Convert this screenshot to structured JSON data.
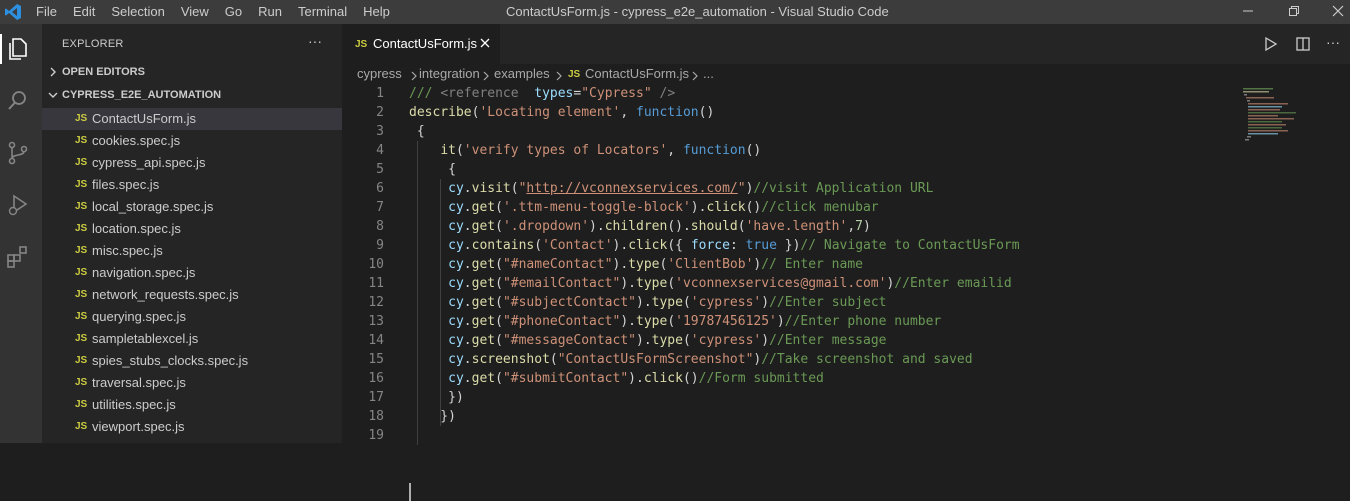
{
  "titlebar": {
    "menu": [
      "File",
      "Edit",
      "Selection",
      "View",
      "Go",
      "Run",
      "Terminal",
      "Help"
    ],
    "title": "ContactUsForm.js - cypress_e2e_automation - Visual Studio Code"
  },
  "sidebar": {
    "title": "EXPLORER",
    "more": "···",
    "open_editors": "OPEN EDITORS",
    "project": "CYPRESS_E2E_AUTOMATION",
    "file_badge": "JS",
    "files": [
      "ContactUsForm.js",
      "cookies.spec.js",
      "cypress_api.spec.js",
      "files.spec.js",
      "local_storage.spec.js",
      "location.spec.js",
      "misc.spec.js",
      "navigation.spec.js",
      "network_requests.spec.js",
      "querying.spec.js",
      "sampletablexcel.js",
      "spies_stubs_clocks.spec.js",
      "traversal.spec.js",
      "utilities.spec.js",
      "viewport.spec.js"
    ],
    "active_index": 0
  },
  "editor": {
    "tab": {
      "badge": "JS",
      "name": "ContactUsForm.js"
    },
    "more": "···",
    "breadcrumb": [
      "cypress",
      "integration",
      "examples",
      "ContactUsForm.js",
      "..."
    ],
    "breadcrumb_badge": "JS",
    "lines": [
      {
        "n": "1",
        "tokens": [
          [
            "/// ",
            "cm"
          ],
          [
            "<",
            "tg"
          ],
          [
            "reference",
            "tg"
          ],
          [
            "  ",
            "pl"
          ],
          [
            "types",
            "at"
          ],
          [
            "=",
            "pl"
          ],
          [
            "\"Cypress\"",
            "st"
          ],
          [
            " />",
            "tg"
          ]
        ]
      },
      {
        "n": "2",
        "tokens": [
          [
            "describe",
            "fn"
          ],
          [
            "(",
            "pl"
          ],
          [
            "'Locating element'",
            "st"
          ],
          [
            ", ",
            "pl"
          ],
          [
            "function",
            "kw"
          ],
          [
            "()",
            "pl"
          ]
        ]
      },
      {
        "n": "3",
        "tokens": [
          [
            " {",
            "pl"
          ]
        ]
      },
      {
        "n": "4",
        "tokens": [
          [
            "    ",
            "pl"
          ],
          [
            "it",
            "fn"
          ],
          [
            "(",
            "pl"
          ],
          [
            "'verify types of Locators'",
            "st"
          ],
          [
            ", ",
            "pl"
          ],
          [
            "function",
            "kw"
          ],
          [
            "()",
            "pl"
          ]
        ]
      },
      {
        "n": "5",
        "tokens": [
          [
            "     {",
            "pl"
          ]
        ]
      },
      {
        "n": "6",
        "tokens": [
          [
            "     ",
            "pl"
          ],
          [
            "cy",
            "vr"
          ],
          [
            ".",
            "pl"
          ],
          [
            "visit",
            "fn"
          ],
          [
            "(",
            "pl"
          ],
          [
            "\"",
            "st"
          ],
          [
            "http://vconnexservices.com/",
            "ul"
          ],
          [
            "\"",
            "st"
          ],
          [
            ")",
            "pl"
          ],
          [
            "//visit Application URL",
            "cm"
          ]
        ]
      },
      {
        "n": "7",
        "tokens": [
          [
            "     ",
            "pl"
          ],
          [
            "cy",
            "vr"
          ],
          [
            ".",
            "pl"
          ],
          [
            "get",
            "fn"
          ],
          [
            "(",
            "pl"
          ],
          [
            "'.ttm-menu-toggle-block'",
            "st"
          ],
          [
            ").",
            "pl"
          ],
          [
            "click",
            "fn"
          ],
          [
            "()",
            "pl"
          ],
          [
            "//click menubar",
            "cm"
          ]
        ]
      },
      {
        "n": "8",
        "tokens": [
          [
            "     ",
            "pl"
          ],
          [
            "cy",
            "vr"
          ],
          [
            ".",
            "pl"
          ],
          [
            "get",
            "fn"
          ],
          [
            "(",
            "pl"
          ],
          [
            "'.dropdown'",
            "st"
          ],
          [
            ").",
            "pl"
          ],
          [
            "children",
            "fn"
          ],
          [
            "().",
            "pl"
          ],
          [
            "should",
            "fn"
          ],
          [
            "(",
            "pl"
          ],
          [
            "'have.length'",
            "st"
          ],
          [
            ",",
            "pl"
          ],
          [
            "7",
            "nu"
          ],
          [
            ")",
            "pl"
          ]
        ]
      },
      {
        "n": "9",
        "tokens": [
          [
            "     ",
            "pl"
          ],
          [
            "cy",
            "vr"
          ],
          [
            ".",
            "pl"
          ],
          [
            "contains",
            "fn"
          ],
          [
            "(",
            "pl"
          ],
          [
            "'Contact'",
            "st"
          ],
          [
            ").",
            "pl"
          ],
          [
            "click",
            "fn"
          ],
          [
            "({ ",
            "pl"
          ],
          [
            "force",
            "vr"
          ],
          [
            ": ",
            "pl"
          ],
          [
            "true",
            "kw"
          ],
          [
            " })",
            "pl"
          ],
          [
            "// Navigate to ContactUsForm",
            "cm"
          ]
        ]
      },
      {
        "n": "10",
        "tokens": [
          [
            "     ",
            "pl"
          ],
          [
            "cy",
            "vr"
          ],
          [
            ".",
            "pl"
          ],
          [
            "get",
            "fn"
          ],
          [
            "(",
            "pl"
          ],
          [
            "\"#nameContact\"",
            "st"
          ],
          [
            ").",
            "pl"
          ],
          [
            "type",
            "fn"
          ],
          [
            "(",
            "pl"
          ],
          [
            "'ClientBob'",
            "st"
          ],
          [
            ")",
            "pl"
          ],
          [
            "// Enter name",
            "cm"
          ]
        ]
      },
      {
        "n": "11",
        "tokens": [
          [
            "     ",
            "pl"
          ],
          [
            "cy",
            "vr"
          ],
          [
            ".",
            "pl"
          ],
          [
            "get",
            "fn"
          ],
          [
            "(",
            "pl"
          ],
          [
            "\"#emailContact\"",
            "st"
          ],
          [
            ").",
            "pl"
          ],
          [
            "type",
            "fn"
          ],
          [
            "(",
            "pl"
          ],
          [
            "'vconnexservices@gmail.com'",
            "st"
          ],
          [
            ")",
            "pl"
          ],
          [
            "//Enter emailid",
            "cm"
          ]
        ]
      },
      {
        "n": "12",
        "tokens": [
          [
            "     ",
            "pl"
          ],
          [
            "cy",
            "vr"
          ],
          [
            ".",
            "pl"
          ],
          [
            "get",
            "fn"
          ],
          [
            "(",
            "pl"
          ],
          [
            "\"#subjectContact\"",
            "st"
          ],
          [
            ").",
            "pl"
          ],
          [
            "type",
            "fn"
          ],
          [
            "(",
            "pl"
          ],
          [
            "'cypress'",
            "st"
          ],
          [
            ")",
            "pl"
          ],
          [
            "//Enter subject",
            "cm"
          ]
        ]
      },
      {
        "n": "13",
        "tokens": [
          [
            "     ",
            "pl"
          ],
          [
            "cy",
            "vr"
          ],
          [
            ".",
            "pl"
          ],
          [
            "get",
            "fn"
          ],
          [
            "(",
            "pl"
          ],
          [
            "\"#phoneContact\"",
            "st"
          ],
          [
            ").",
            "pl"
          ],
          [
            "type",
            "fn"
          ],
          [
            "(",
            "pl"
          ],
          [
            "'19787456125'",
            "st"
          ],
          [
            ")",
            "pl"
          ],
          [
            "//Enter phone number",
            "cm"
          ]
        ]
      },
      {
        "n": "14",
        "tokens": [
          [
            "     ",
            "pl"
          ],
          [
            "cy",
            "vr"
          ],
          [
            ".",
            "pl"
          ],
          [
            "get",
            "fn"
          ],
          [
            "(",
            "pl"
          ],
          [
            "\"#messageContact\"",
            "st"
          ],
          [
            ").",
            "pl"
          ],
          [
            "type",
            "fn"
          ],
          [
            "(",
            "pl"
          ],
          [
            "'cypress'",
            "st"
          ],
          [
            ")",
            "pl"
          ],
          [
            "//Enter message",
            "cm"
          ]
        ]
      },
      {
        "n": "15",
        "tokens": [
          [
            "     ",
            "pl"
          ],
          [
            "cy",
            "vr"
          ],
          [
            ".",
            "pl"
          ],
          [
            "screenshot",
            "fn"
          ],
          [
            "(",
            "pl"
          ],
          [
            "\"ContactUsFormScreenshot\"",
            "st"
          ],
          [
            ")",
            "pl"
          ],
          [
            "//Take screenshot and saved",
            "cm"
          ]
        ]
      },
      {
        "n": "16",
        "tokens": [
          [
            "     ",
            "pl"
          ],
          [
            "cy",
            "vr"
          ],
          [
            ".",
            "pl"
          ],
          [
            "get",
            "fn"
          ],
          [
            "(",
            "pl"
          ],
          [
            "\"#submitContact\"",
            "st"
          ],
          [
            ").",
            "pl"
          ],
          [
            "click",
            "fn"
          ],
          [
            "()",
            "pl"
          ],
          [
            "//Form submitted",
            "cm"
          ]
        ]
      },
      {
        "n": "17",
        "tokens": [
          [
            "     })",
            "pl"
          ]
        ]
      },
      {
        "n": "18",
        "tokens": [
          [
            "    })",
            "pl"
          ]
        ]
      },
      {
        "n": "19",
        "tokens": []
      }
    ]
  },
  "colors": {
    "pl": "#d4d4d4",
    "cm": "#6a9955",
    "st": "#ce9178",
    "kw": "#569cd6",
    "fn": "#dcdcaa",
    "vr": "#9cdcfe",
    "nu": "#b5cea8",
    "tg": "#808080",
    "at": "#9cdcfe",
    "ul": "#ce9178"
  }
}
